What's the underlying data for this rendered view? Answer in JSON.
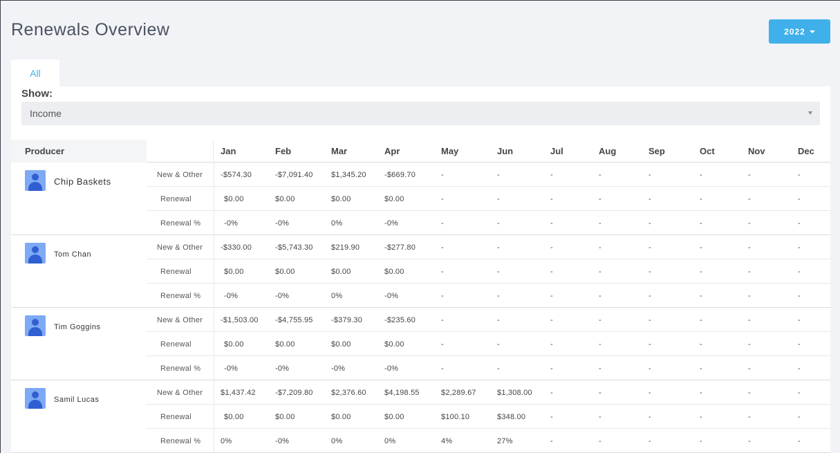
{
  "page_title": "Renewals Overview",
  "year_selector": {
    "label": "2022"
  },
  "tabs": [
    {
      "label": "All",
      "active": true
    }
  ],
  "show": {
    "label": "Show:",
    "selected": "Income"
  },
  "table": {
    "producer_header": "Producer",
    "months": [
      "Jan",
      "Feb",
      "Mar",
      "Apr",
      "May",
      "Jun",
      "Jul",
      "Aug",
      "Sep",
      "Oct",
      "Nov",
      "Dec"
    ],
    "row_labels": [
      "New & Other",
      "Renewal",
      "Renewal %"
    ],
    "producers": [
      {
        "name": "Chip Baskets",
        "rows": [
          [
            "-$574.30",
            "-$7,091.40",
            "$1,345.20",
            "-$669.70",
            "-",
            "-",
            "-",
            "-",
            "-",
            "-",
            "-",
            "-"
          ],
          [
            "$0.00",
            "$0.00",
            "$0.00",
            "$0.00",
            "-",
            "-",
            "-",
            "-",
            "-",
            "-",
            "-",
            "-"
          ],
          [
            "-0%",
            "-0%",
            "0%",
            "-0%",
            "-",
            "-",
            "-",
            "-",
            "-",
            "-",
            "-",
            "-"
          ]
        ]
      },
      {
        "name": "Tom Chan",
        "rows": [
          [
            "-$330.00",
            "-$5,743.30",
            "$219.90",
            "-$277.80",
            "-",
            "-",
            "-",
            "-",
            "-",
            "-",
            "-",
            "-"
          ],
          [
            "$0.00",
            "$0.00",
            "$0.00",
            "$0.00",
            "-",
            "-",
            "-",
            "-",
            "-",
            "-",
            "-",
            "-"
          ],
          [
            "-0%",
            "-0%",
            "0%",
            "-0%",
            "-",
            "-",
            "-",
            "-",
            "-",
            "-",
            "-",
            "-"
          ]
        ]
      },
      {
        "name": "Tim Goggins",
        "rows": [
          [
            "-$1,503.00",
            "-$4,755.95",
            "-$379.30",
            "-$235.60",
            "-",
            "-",
            "-",
            "-",
            "-",
            "-",
            "-",
            "-"
          ],
          [
            "$0.00",
            "$0.00",
            "$0.00",
            "$0.00",
            "-",
            "-",
            "-",
            "-",
            "-",
            "-",
            "-",
            "-"
          ],
          [
            "-0%",
            "-0%",
            "-0%",
            "-0%",
            "-",
            "-",
            "-",
            "-",
            "-",
            "-",
            "-",
            "-"
          ]
        ]
      },
      {
        "name": "Samil Lucas",
        "rows": [
          [
            "$1,437.42",
            "-$7,209.80",
            "$2,376.60",
            "$4,198.55",
            "$2,289.67",
            "$1,308.00",
            "-",
            "-",
            "-",
            "-",
            "-",
            "-"
          ],
          [
            "$0.00",
            "$0.00",
            "$0.00",
            "$0.00",
            "$100.10",
            "$348.00",
            "-",
            "-",
            "-",
            "-",
            "-",
            "-"
          ],
          [
            "0%",
            "-0%",
            "0%",
            "0%",
            "4%",
            "27%",
            "-",
            "-",
            "-",
            "-",
            "-",
            "-"
          ]
        ]
      }
    ]
  }
}
